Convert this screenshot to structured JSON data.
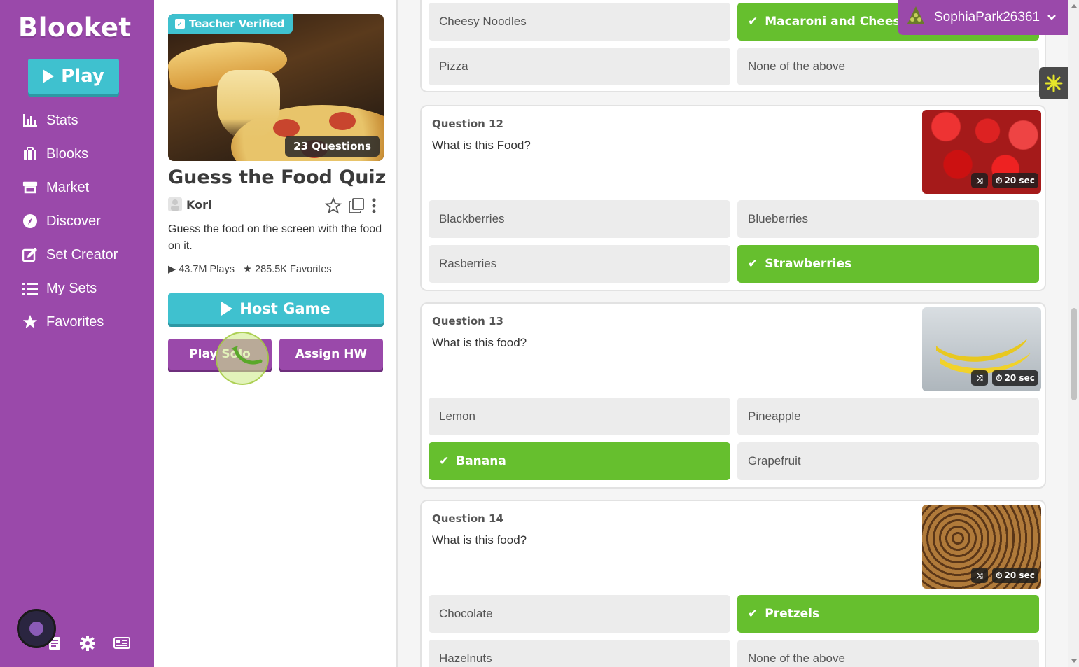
{
  "app": {
    "logo_text": "Blooket",
    "play_label": "Play"
  },
  "sidebar": {
    "items": [
      {
        "label": "Stats",
        "icon": "stats-icon"
      },
      {
        "label": "Blooks",
        "icon": "blooks-icon"
      },
      {
        "label": "Market",
        "icon": "market-icon"
      },
      {
        "label": "Discover",
        "icon": "discover-icon"
      },
      {
        "label": "Set Creator",
        "icon": "set-creator-icon"
      },
      {
        "label": "My Sets",
        "icon": "list-icon"
      },
      {
        "label": "Favorites",
        "icon": "star-icon"
      }
    ],
    "bottom_icons": [
      "news-icon",
      "gear-icon",
      "newspaper-icon"
    ]
  },
  "set": {
    "verified_label": "Teacher Verified",
    "question_count": "23 Questions",
    "title": "Guess the Food Quiz",
    "author": "Kori",
    "description": "Guess the food on the screen with the food on it.",
    "plays": "43.7M Plays",
    "favorites": "285.5K Favorites",
    "host_label": "Host Game",
    "solo_label": "Play Solo",
    "assign_label": "Assign HW"
  },
  "user": {
    "username": "SophiaPark26361"
  },
  "questions": [
    {
      "label": "",
      "text": "",
      "answers": [
        {
          "text": "Cheesy Noodles",
          "correct": false
        },
        {
          "text": "Macaroni and Cheese",
          "correct": true
        },
        {
          "text": "Pizza",
          "correct": false
        },
        {
          "text": "None of the above",
          "correct": false
        }
      ]
    },
    {
      "label": "Question 12",
      "text": "What is this Food?",
      "time": "20 sec",
      "answers": [
        {
          "text": "Blackberries",
          "correct": false
        },
        {
          "text": "Blueberries",
          "correct": false
        },
        {
          "text": "Rasberries",
          "correct": false
        },
        {
          "text": "Strawberries",
          "correct": true
        }
      ]
    },
    {
      "label": "Question 13",
      "text": "What is this food?",
      "time": "20 sec",
      "answers": [
        {
          "text": "Lemon",
          "correct": false
        },
        {
          "text": "Pineapple",
          "correct": false
        },
        {
          "text": "Banana",
          "correct": true
        },
        {
          "text": "Grapefruit",
          "correct": false
        }
      ]
    },
    {
      "label": "Question 14",
      "text": "What is this food?",
      "time": "20 sec",
      "answers": [
        {
          "text": "Chocolate",
          "correct": false
        },
        {
          "text": "Pretzels",
          "correct": true
        },
        {
          "text": "Hazelnuts",
          "correct": false
        },
        {
          "text": "None of the above",
          "correct": false
        }
      ]
    }
  ],
  "colors": {
    "sidebar": "#9a49aa",
    "accent": "#3fc1cf",
    "correct": "#66bf2e",
    "answer_bg": "#ececec"
  }
}
